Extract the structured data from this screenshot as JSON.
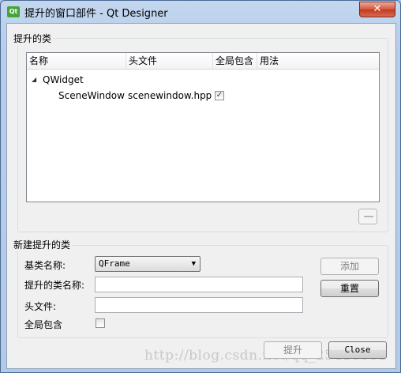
{
  "window": {
    "title": "提升的窗口部件 - Qt Designer",
    "icon_text": "Qt",
    "close_glyph": "✕"
  },
  "promoted_group": {
    "title": "提升的类",
    "columns": [
      "名称",
      "头文件",
      "全局包含",
      "用法"
    ],
    "rows": [
      {
        "expander": "◢",
        "name": "QWidget",
        "level": 0
      },
      {
        "name": "SceneWindow",
        "header": "scenewindow.hpp",
        "global_include": true,
        "level": 1
      }
    ],
    "remove_button_icon": "minus-icon"
  },
  "new_group": {
    "title": "新建提升的类",
    "base_class_label": "基类名称:",
    "base_class_value": "QFrame",
    "promoted_name_label": "提升的类名称:",
    "promoted_name_value": "",
    "header_file_label": "头文件:",
    "header_file_value": "",
    "global_include_label": "全局包含",
    "global_include_checked": false,
    "add_button": "添加",
    "reset_button": "重置"
  },
  "footer": {
    "promote_button": "提升",
    "close_button": "Close"
  },
  "watermark": "http://blog.csdn.net/qq_25416061"
}
